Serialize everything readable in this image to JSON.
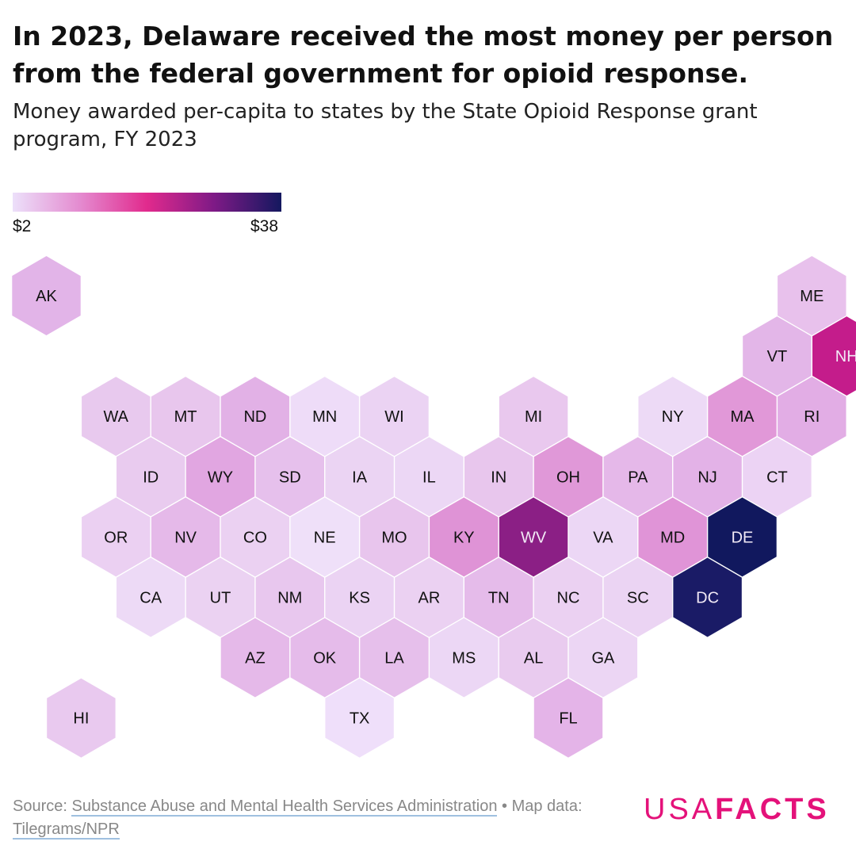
{
  "title": "In 2023, Delaware received the most money per person from the federal government for opioid response.",
  "subtitle": "Money awarded per-capita to states by the State Opioid Response grant program, FY 2023",
  "legend": {
    "min_label": "$2",
    "max_label": "$38",
    "gradient_colors": [
      "#ece0fa",
      "#e48bd0",
      "#e12a8d",
      "#7e1a86",
      "#14185f"
    ]
  },
  "states": [
    {
      "abbr": "AK",
      "col": 0,
      "row": 0,
      "color": "#e2b4e8"
    },
    {
      "abbr": "ME",
      "col": 11,
      "row": 0,
      "color": "#e8c1ec"
    },
    {
      "abbr": "VT",
      "col": 10,
      "row": 1,
      "color": "#e3b6e8"
    },
    {
      "abbr": "NH",
      "col": 11,
      "row": 1,
      "color": "#c41c8b",
      "dark": true
    },
    {
      "abbr": "WA",
      "col": 1,
      "row": 2,
      "color": "#e8c9ee"
    },
    {
      "abbr": "MT",
      "col": 2,
      "row": 2,
      "color": "#e8c6ed"
    },
    {
      "abbr": "ND",
      "col": 3,
      "row": 2,
      "color": "#e2b1e6"
    },
    {
      "abbr": "MN",
      "col": 4,
      "row": 2,
      "color": "#eedcf8"
    },
    {
      "abbr": "WI",
      "col": 5,
      "row": 2,
      "color": "#ebd3f3"
    },
    {
      "abbr": "MI",
      "col": 7,
      "row": 2,
      "color": "#e9c8ee"
    },
    {
      "abbr": "NY",
      "col": 9,
      "row": 2,
      "color": "#eddaf6"
    },
    {
      "abbr": "MA",
      "col": 10,
      "row": 2,
      "color": "#e198d8"
    },
    {
      "abbr": "RI",
      "col": 11,
      "row": 2,
      "color": "#e2ade5"
    },
    {
      "abbr": "ID",
      "col": 1,
      "row": 3,
      "color": "#e9cbef"
    },
    {
      "abbr": "WY",
      "col": 2,
      "row": 3,
      "color": "#e1a6e1"
    },
    {
      "abbr": "SD",
      "col": 3,
      "row": 3,
      "color": "#e6c0ec"
    },
    {
      "abbr": "IA",
      "col": 4,
      "row": 3,
      "color": "#ebd4f3"
    },
    {
      "abbr": "IL",
      "col": 5,
      "row": 3,
      "color": "#ecd7f5"
    },
    {
      "abbr": "IN",
      "col": 6,
      "row": 3,
      "color": "#e8c6ed"
    },
    {
      "abbr": "OH",
      "col": 7,
      "row": 3,
      "color": "#e098d8"
    },
    {
      "abbr": "PA",
      "col": 8,
      "row": 3,
      "color": "#e5b8e9"
    },
    {
      "abbr": "NJ",
      "col": 9,
      "row": 3,
      "color": "#e3b2e7"
    },
    {
      "abbr": "CT",
      "col": 10,
      "row": 3,
      "color": "#ecd3f4"
    },
    {
      "abbr": "OR",
      "col": 1,
      "row": 4,
      "color": "#ebd0f2"
    },
    {
      "abbr": "NV",
      "col": 2,
      "row": 4,
      "color": "#e5b9e9"
    },
    {
      "abbr": "CO",
      "col": 3,
      "row": 4,
      "color": "#ebd1f2"
    },
    {
      "abbr": "NE",
      "col": 4,
      "row": 4,
      "color": "#efe0f9"
    },
    {
      "abbr": "MO",
      "col": 5,
      "row": 4,
      "color": "#e8c5ed"
    },
    {
      "abbr": "KY",
      "col": 6,
      "row": 4,
      "color": "#df93d6"
    },
    {
      "abbr": "WV",
      "col": 7,
      "row": 4,
      "color": "#8b1f85",
      "dark": true
    },
    {
      "abbr": "VA",
      "col": 8,
      "row": 4,
      "color": "#ecd7f5"
    },
    {
      "abbr": "MD",
      "col": 9,
      "row": 4,
      "color": "#e094d7"
    },
    {
      "abbr": "DE",
      "col": 10,
      "row": 4,
      "color": "#11185e",
      "dark": true
    },
    {
      "abbr": "CA",
      "col": 1,
      "row": 5,
      "color": "#eddaf6"
    },
    {
      "abbr": "UT",
      "col": 2,
      "row": 5,
      "color": "#ebd2f2"
    },
    {
      "abbr": "NM",
      "col": 3,
      "row": 5,
      "color": "#e8c7ee"
    },
    {
      "abbr": "KS",
      "col": 4,
      "row": 5,
      "color": "#ebd3f3"
    },
    {
      "abbr": "AR",
      "col": 5,
      "row": 5,
      "color": "#ebd1f2"
    },
    {
      "abbr": "TN",
      "col": 6,
      "row": 5,
      "color": "#e5bbea"
    },
    {
      "abbr": "NC",
      "col": 7,
      "row": 5,
      "color": "#ebd1f2"
    },
    {
      "abbr": "SC",
      "col": 8,
      "row": 5,
      "color": "#ebd4f3"
    },
    {
      "abbr": "DC",
      "col": 9,
      "row": 5,
      "color": "#1a1b66",
      "dark": true
    },
    {
      "abbr": "AZ",
      "col": 3,
      "row": 6,
      "color": "#e5b9e9"
    },
    {
      "abbr": "OK",
      "col": 4,
      "row": 6,
      "color": "#e5bbea"
    },
    {
      "abbr": "LA",
      "col": 5,
      "row": 6,
      "color": "#e6bfeb"
    },
    {
      "abbr": "MS",
      "col": 6,
      "row": 6,
      "color": "#ecd7f5"
    },
    {
      "abbr": "AL",
      "col": 7,
      "row": 6,
      "color": "#e9cbef"
    },
    {
      "abbr": "GA",
      "col": 8,
      "row": 6,
      "color": "#ecd6f4"
    },
    {
      "abbr": "HI",
      "col": 0,
      "row": 7,
      "color": "#e9c9ef"
    },
    {
      "abbr": "TX",
      "col": 4,
      "row": 7,
      "color": "#efdffa"
    },
    {
      "abbr": "FL",
      "col": 7,
      "row": 7,
      "color": "#e4b4e8"
    }
  ],
  "source": {
    "prefix": "Source: ",
    "agency": "Substance Abuse and Mental Health Services Administration",
    "separator": " • Map data: ",
    "map_credit": "Tilegrams/NPR"
  },
  "logo": {
    "usa": "USA",
    "facts": "FACTS",
    "color": "#e4127a"
  }
}
